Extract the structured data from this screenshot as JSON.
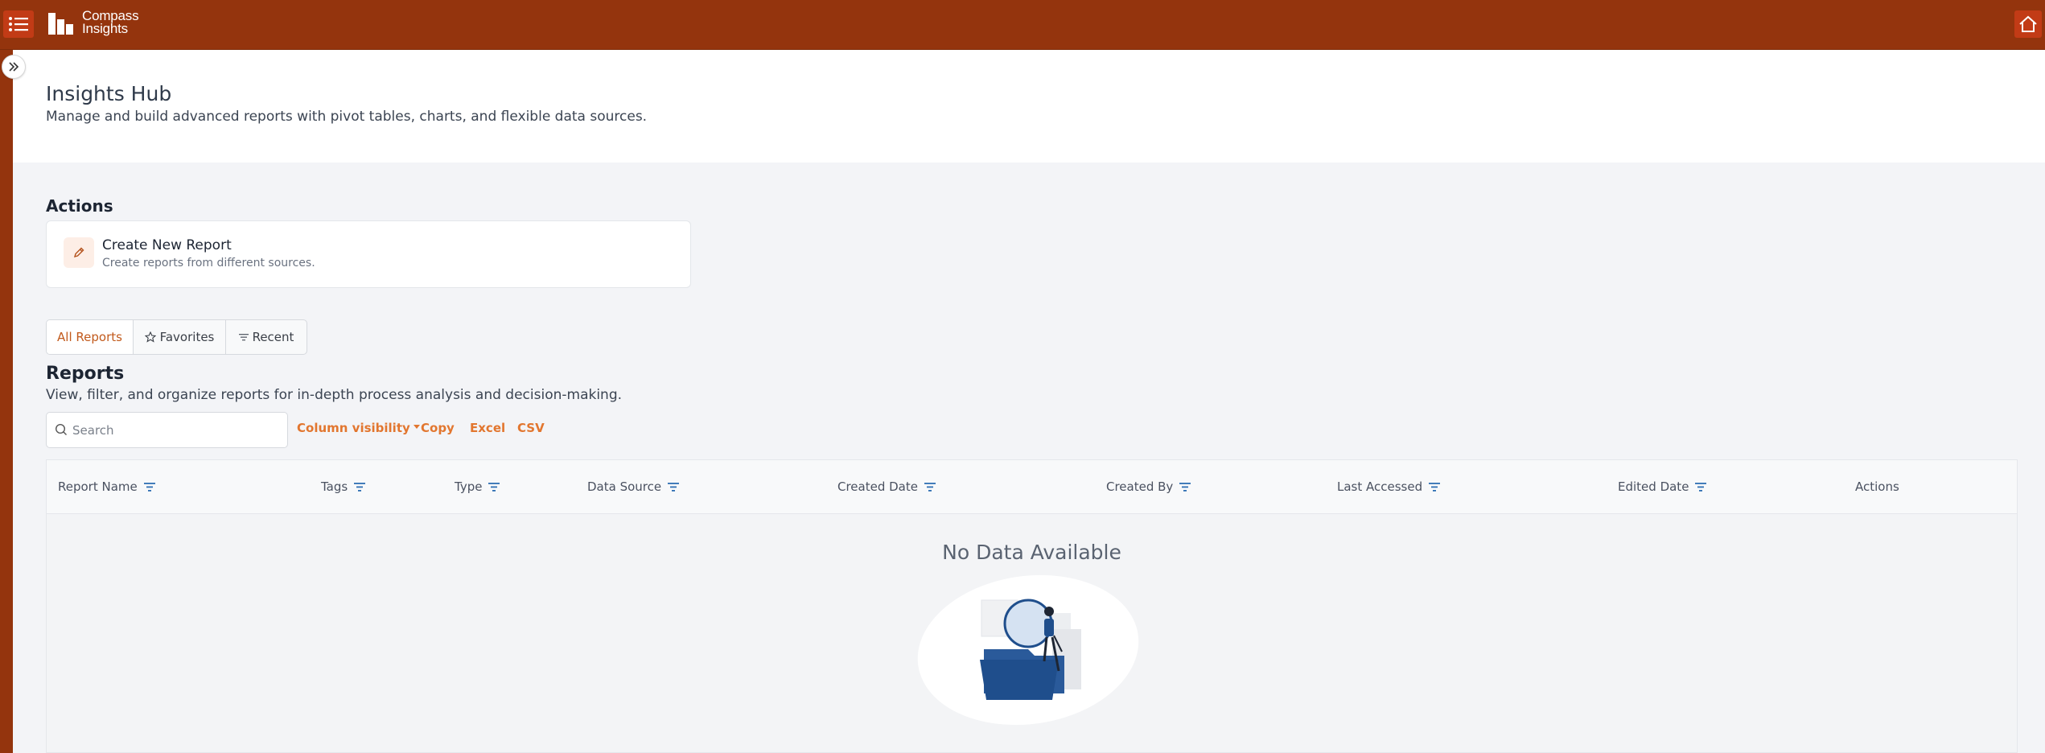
{
  "app": {
    "brand_line1": "Compass",
    "brand_line2": "Insights"
  },
  "header": {
    "title": "Insights Hub",
    "subtitle": "Manage and build advanced reports with pivot tables, charts, and flexible data sources."
  },
  "actions": {
    "title": "Actions",
    "items": [
      {
        "label": "Create New Report",
        "description": "Create reports from different sources.",
        "icon": "pencil-icon"
      }
    ]
  },
  "tabs": [
    {
      "label": "All Reports",
      "active": true
    },
    {
      "label": "Favorites",
      "icon": "star-icon"
    },
    {
      "label": "Recent",
      "icon": "filter-lines-icon"
    }
  ],
  "reports": {
    "title": "Reports",
    "subtitle": "View, filter, and organize reports for in-depth process analysis and decision-making."
  },
  "toolbar": {
    "search_placeholder": "Search",
    "column_visibility": "Column visibility",
    "copy": "Copy",
    "excel": "Excel",
    "csv": "CSV"
  },
  "table": {
    "columns": [
      "Report Name",
      "Tags",
      "Type",
      "Data Source",
      "Created Date",
      "Created By",
      "Last Accessed",
      "Edited Date",
      "Actions"
    ],
    "rows": [],
    "empty_text": "No Data Available"
  },
  "colors": {
    "topbar": "#94340d",
    "accent": "#e2762f",
    "button_bg": "#c23b16",
    "illustration_blue": "#1f4e8c"
  }
}
